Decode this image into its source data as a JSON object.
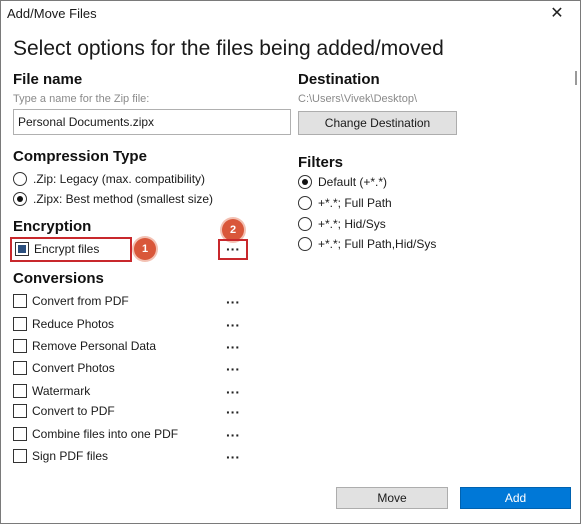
{
  "window": {
    "title": "Add/Move Files",
    "close_glyph": "✕"
  },
  "heading": "Select options for the files being added/moved",
  "file_name": {
    "label": "File name",
    "placeholder_hint": "Type a name for the Zip file:",
    "value": "Personal Documents.zipx"
  },
  "destination": {
    "label": "Destination",
    "path": "C:\\Users\\Vivek\\Desktop\\",
    "change_button": "Change Destination"
  },
  "compression": {
    "label": "Compression Type",
    "options": [
      {
        "label": ".Zip: Legacy (max. compatibility)",
        "selected": false
      },
      {
        "label": ".Zipx: Best method (smallest size)",
        "selected": true
      }
    ]
  },
  "filters": {
    "label": "Filters",
    "options": [
      {
        "label": "Default (+*.*)",
        "selected": true
      },
      {
        "label": "+*.*; Full Path",
        "selected": false
      },
      {
        "label": "+*.*; Hid/Sys",
        "selected": false
      },
      {
        "label": "+*.*; Full Path,Hid/Sys",
        "selected": false
      }
    ]
  },
  "encryption": {
    "label": "Encryption",
    "encrypt_files": {
      "label": "Encrypt files",
      "checked": "partial"
    },
    "more_glyph": "···",
    "callouts": [
      "1",
      "2"
    ],
    "accent_color": "#c8282c"
  },
  "conversions": {
    "label": "Conversions",
    "more_glyph": "···",
    "items": [
      {
        "label": "Convert from PDF",
        "checked": false
      },
      {
        "label": "Reduce Photos",
        "checked": false
      },
      {
        "label": "Remove Personal Data",
        "checked": false
      },
      {
        "label": "Convert Photos",
        "checked": false
      },
      {
        "label": "Watermark",
        "checked": false
      },
      {
        "label": "Convert to PDF",
        "checked": false
      },
      {
        "label": "Combine files into one PDF",
        "checked": false
      },
      {
        "label": "Sign PDF files",
        "checked": false
      }
    ]
  },
  "footer": {
    "move_button": "Move",
    "add_button": "Add",
    "primary_color": "#0078d7"
  }
}
